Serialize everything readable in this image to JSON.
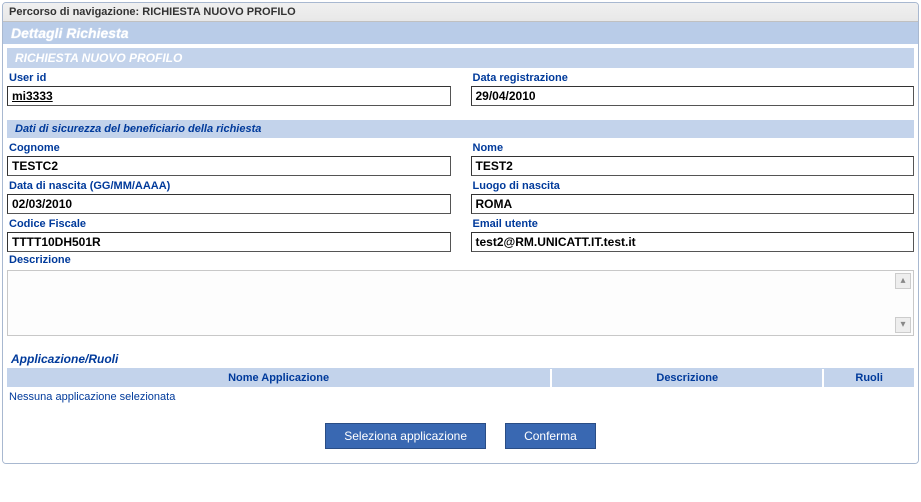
{
  "breadcrumb": {
    "label": "Percorso di navigazione:",
    "value": "RICHIESTA NUOVO PROFILO"
  },
  "title": "Dettagli Richiesta",
  "section1": {
    "header": "RICHIESTA NUOVO PROFILO",
    "user_id_label": "User id",
    "user_id_value": "mi3333",
    "reg_date_label": "Data registrazione",
    "reg_date_value": "29/04/2010"
  },
  "section2": {
    "header": "Dati di sicurezza del beneficiario della richiesta",
    "cognome_label": "Cognome",
    "cognome_value": "TESTC2",
    "nome_label": "Nome",
    "nome_value": "TEST2",
    "dob_label": "Data di nascita (GG/MM/AAAA)",
    "dob_value": "02/03/2010",
    "luogo_label": "Luogo di nascita",
    "luogo_value": "ROMA",
    "cf_label": "Codice Fiscale",
    "cf_value": "TTTT10DH501R",
    "email_label": "Email utente",
    "email_value": "test2@RM.UNICATT.IT.test.it",
    "descrizione_label": "Descrizione",
    "descrizione_value": ""
  },
  "app_section": {
    "header": "Applicazione/Ruoli",
    "col_nome": "Nome Applicazione",
    "col_desc": "Descrizione",
    "col_ruoli": "Ruoli",
    "empty_msg": "Nessuna applicazione selezionata"
  },
  "buttons": {
    "seleziona": "Seleziona applicazione",
    "conferma": "Conferma"
  }
}
